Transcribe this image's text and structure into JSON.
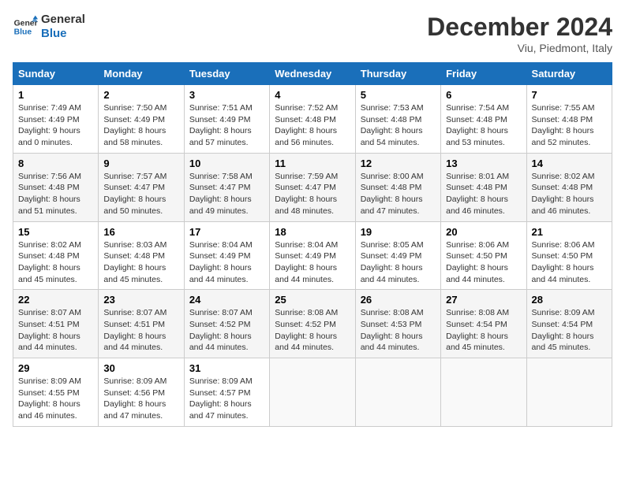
{
  "header": {
    "logo_line1": "General",
    "logo_line2": "Blue",
    "month": "December 2024",
    "location": "Viu, Piedmont, Italy"
  },
  "weekdays": [
    "Sunday",
    "Monday",
    "Tuesday",
    "Wednesday",
    "Thursday",
    "Friday",
    "Saturday"
  ],
  "weeks": [
    [
      {
        "day": "1",
        "sunrise": "Sunrise: 7:49 AM",
        "sunset": "Sunset: 4:49 PM",
        "daylight": "Daylight: 9 hours and 0 minutes."
      },
      {
        "day": "2",
        "sunrise": "Sunrise: 7:50 AM",
        "sunset": "Sunset: 4:49 PM",
        "daylight": "Daylight: 8 hours and 58 minutes."
      },
      {
        "day": "3",
        "sunrise": "Sunrise: 7:51 AM",
        "sunset": "Sunset: 4:49 PM",
        "daylight": "Daylight: 8 hours and 57 minutes."
      },
      {
        "day": "4",
        "sunrise": "Sunrise: 7:52 AM",
        "sunset": "Sunset: 4:48 PM",
        "daylight": "Daylight: 8 hours and 56 minutes."
      },
      {
        "day": "5",
        "sunrise": "Sunrise: 7:53 AM",
        "sunset": "Sunset: 4:48 PM",
        "daylight": "Daylight: 8 hours and 54 minutes."
      },
      {
        "day": "6",
        "sunrise": "Sunrise: 7:54 AM",
        "sunset": "Sunset: 4:48 PM",
        "daylight": "Daylight: 8 hours and 53 minutes."
      },
      {
        "day": "7",
        "sunrise": "Sunrise: 7:55 AM",
        "sunset": "Sunset: 4:48 PM",
        "daylight": "Daylight: 8 hours and 52 minutes."
      }
    ],
    [
      {
        "day": "8",
        "sunrise": "Sunrise: 7:56 AM",
        "sunset": "Sunset: 4:48 PM",
        "daylight": "Daylight: 8 hours and 51 minutes."
      },
      {
        "day": "9",
        "sunrise": "Sunrise: 7:57 AM",
        "sunset": "Sunset: 4:47 PM",
        "daylight": "Daylight: 8 hours and 50 minutes."
      },
      {
        "day": "10",
        "sunrise": "Sunrise: 7:58 AM",
        "sunset": "Sunset: 4:47 PM",
        "daylight": "Daylight: 8 hours and 49 minutes."
      },
      {
        "day": "11",
        "sunrise": "Sunrise: 7:59 AM",
        "sunset": "Sunset: 4:47 PM",
        "daylight": "Daylight: 8 hours and 48 minutes."
      },
      {
        "day": "12",
        "sunrise": "Sunrise: 8:00 AM",
        "sunset": "Sunset: 4:48 PM",
        "daylight": "Daylight: 8 hours and 47 minutes."
      },
      {
        "day": "13",
        "sunrise": "Sunrise: 8:01 AM",
        "sunset": "Sunset: 4:48 PM",
        "daylight": "Daylight: 8 hours and 46 minutes."
      },
      {
        "day": "14",
        "sunrise": "Sunrise: 8:02 AM",
        "sunset": "Sunset: 4:48 PM",
        "daylight": "Daylight: 8 hours and 46 minutes."
      }
    ],
    [
      {
        "day": "15",
        "sunrise": "Sunrise: 8:02 AM",
        "sunset": "Sunset: 4:48 PM",
        "daylight": "Daylight: 8 hours and 45 minutes."
      },
      {
        "day": "16",
        "sunrise": "Sunrise: 8:03 AM",
        "sunset": "Sunset: 4:48 PM",
        "daylight": "Daylight: 8 hours and 45 minutes."
      },
      {
        "day": "17",
        "sunrise": "Sunrise: 8:04 AM",
        "sunset": "Sunset: 4:49 PM",
        "daylight": "Daylight: 8 hours and 44 minutes."
      },
      {
        "day": "18",
        "sunrise": "Sunrise: 8:04 AM",
        "sunset": "Sunset: 4:49 PM",
        "daylight": "Daylight: 8 hours and 44 minutes."
      },
      {
        "day": "19",
        "sunrise": "Sunrise: 8:05 AM",
        "sunset": "Sunset: 4:49 PM",
        "daylight": "Daylight: 8 hours and 44 minutes."
      },
      {
        "day": "20",
        "sunrise": "Sunrise: 8:06 AM",
        "sunset": "Sunset: 4:50 PM",
        "daylight": "Daylight: 8 hours and 44 minutes."
      },
      {
        "day": "21",
        "sunrise": "Sunrise: 8:06 AM",
        "sunset": "Sunset: 4:50 PM",
        "daylight": "Daylight: 8 hours and 44 minutes."
      }
    ],
    [
      {
        "day": "22",
        "sunrise": "Sunrise: 8:07 AM",
        "sunset": "Sunset: 4:51 PM",
        "daylight": "Daylight: 8 hours and 44 minutes."
      },
      {
        "day": "23",
        "sunrise": "Sunrise: 8:07 AM",
        "sunset": "Sunset: 4:51 PM",
        "daylight": "Daylight: 8 hours and 44 minutes."
      },
      {
        "day": "24",
        "sunrise": "Sunrise: 8:07 AM",
        "sunset": "Sunset: 4:52 PM",
        "daylight": "Daylight: 8 hours and 44 minutes."
      },
      {
        "day": "25",
        "sunrise": "Sunrise: 8:08 AM",
        "sunset": "Sunset: 4:52 PM",
        "daylight": "Daylight: 8 hours and 44 minutes."
      },
      {
        "day": "26",
        "sunrise": "Sunrise: 8:08 AM",
        "sunset": "Sunset: 4:53 PM",
        "daylight": "Daylight: 8 hours and 44 minutes."
      },
      {
        "day": "27",
        "sunrise": "Sunrise: 8:08 AM",
        "sunset": "Sunset: 4:54 PM",
        "daylight": "Daylight: 8 hours and 45 minutes."
      },
      {
        "day": "28",
        "sunrise": "Sunrise: 8:09 AM",
        "sunset": "Sunset: 4:54 PM",
        "daylight": "Daylight: 8 hours and 45 minutes."
      }
    ],
    [
      {
        "day": "29",
        "sunrise": "Sunrise: 8:09 AM",
        "sunset": "Sunset: 4:55 PM",
        "daylight": "Daylight: 8 hours and 46 minutes."
      },
      {
        "day": "30",
        "sunrise": "Sunrise: 8:09 AM",
        "sunset": "Sunset: 4:56 PM",
        "daylight": "Daylight: 8 hours and 47 minutes."
      },
      {
        "day": "31",
        "sunrise": "Sunrise: 8:09 AM",
        "sunset": "Sunset: 4:57 PM",
        "daylight": "Daylight: 8 hours and 47 minutes."
      },
      null,
      null,
      null,
      null
    ]
  ]
}
